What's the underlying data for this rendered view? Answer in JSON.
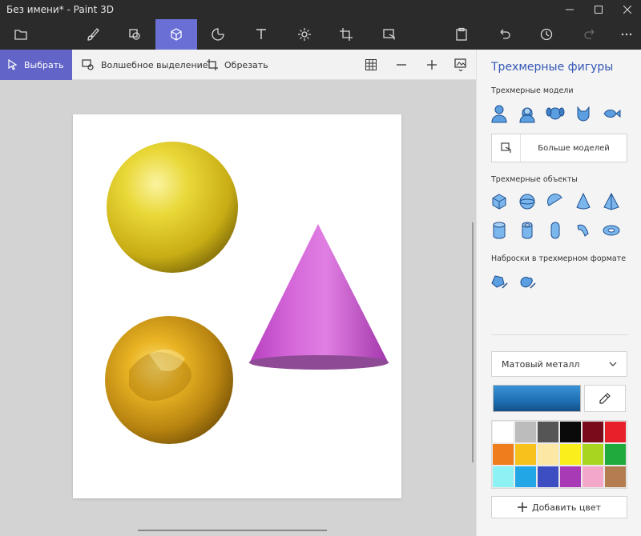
{
  "window": {
    "title": "Без имени* - Paint 3D",
    "min_icon": "minimize-icon",
    "max_icon": "maximize-icon",
    "close_icon": "close-icon"
  },
  "toolbar": {
    "active_tool": "3d-shapes",
    "tools": [
      "folder-icon",
      "brush-icon",
      "2d-shapes-icon",
      "3d-shapes-icon",
      "stickers-icon",
      "text-icon",
      "effects-icon",
      "canvas-icon",
      "mixed-reality-icon",
      "paste-icon",
      "undo-icon",
      "history-icon",
      "redo-icon",
      "more-icon"
    ]
  },
  "subbar": {
    "select_label": "Выбрать",
    "magic_select_label": "Волшебное выделение",
    "crop_label": "Обрезать"
  },
  "panel": {
    "title": "Трехмерные фигуры",
    "models_label": "Трехмерные модели",
    "more_models_label": "Больше моделей",
    "objects_label": "Трехмерные объекты",
    "doodles_label": "Наброски в трехмерном формате",
    "material": "Матовый металл",
    "add_color_label": "Добавить цвет",
    "current_color": "#1e6fb4",
    "palette": [
      "#ffffff",
      "#bcbcbc",
      "#555555",
      "#0a0a0a",
      "#7a0b1a",
      "#e8202a",
      "#f07d1c",
      "#f7c21b",
      "#fce7a4",
      "#f9ef1d",
      "#a8d51f",
      "#1faa3b",
      "#8ef1f3",
      "#22a6e6",
      "#3c4ec1",
      "#a83ab6",
      "#f3a8c9",
      "#b47d4f"
    ]
  },
  "canvas": {
    "background": "#ffffff",
    "objects": [
      "yellow-sphere",
      "golden-sphere",
      "magenta-cone"
    ]
  }
}
